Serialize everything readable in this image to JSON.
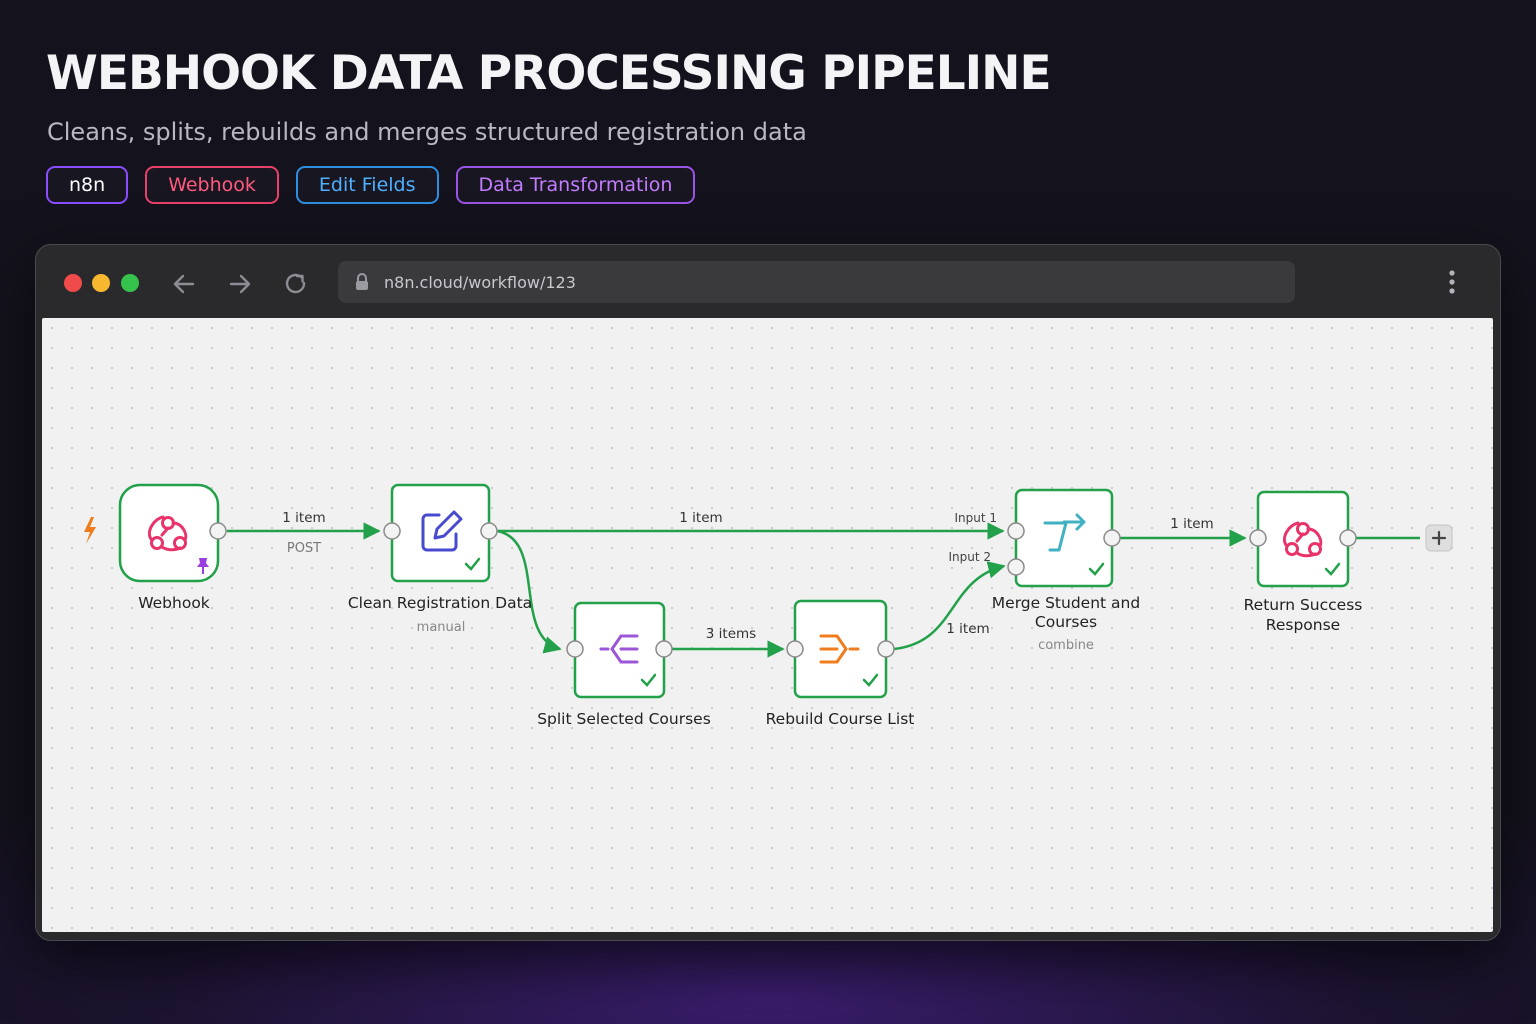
{
  "hero": {
    "title": "WEBHOOK DATA PROCESSING PIPELINE",
    "subtitle": "Cleans, splits, rebuilds and merges structured registration data",
    "tags": [
      "n8n",
      "Webhook",
      "Edit Fields",
      "Data Transformation"
    ]
  },
  "browser": {
    "url": "n8n.cloud/workflow/123"
  },
  "workflow": {
    "nodes": {
      "webhook": {
        "label": "Webhook",
        "icon": "webhook-icon",
        "color": "#e8346a"
      },
      "clean": {
        "label": "Clean Registration Data",
        "sublabel": "manual",
        "icon": "edit-pencil-icon",
        "color": "#4a4ad0"
      },
      "split": {
        "label": "Split Selected Courses",
        "icon": "split-out-icon",
        "color": "#9b55d6"
      },
      "rebuild": {
        "label": "Rebuild Course List",
        "icon": "aggregate-icon",
        "color": "#f07c1e"
      },
      "merge": {
        "label_line1": "Merge Student and",
        "label_line2": "Courses",
        "sublabel": "combine",
        "icon": "merge-icon",
        "color": "#3fb1c2"
      },
      "respond": {
        "label_line1": "Return Success",
        "label_line2": "Response",
        "icon": "webhook-icon",
        "color": "#e8346a"
      }
    },
    "edges": {
      "webhook_to_clean": {
        "count": "1 item",
        "method": "POST"
      },
      "clean_to_merge": {
        "count": "1 item"
      },
      "split_to_rebuild": {
        "count": "3 items"
      },
      "rebuild_to_merge": {
        "count": "1 item"
      },
      "merge_to_respond": {
        "count": "1 item"
      }
    },
    "merge_inputs": [
      "Input 1",
      "Input 2"
    ],
    "accent": "#22a04a"
  }
}
